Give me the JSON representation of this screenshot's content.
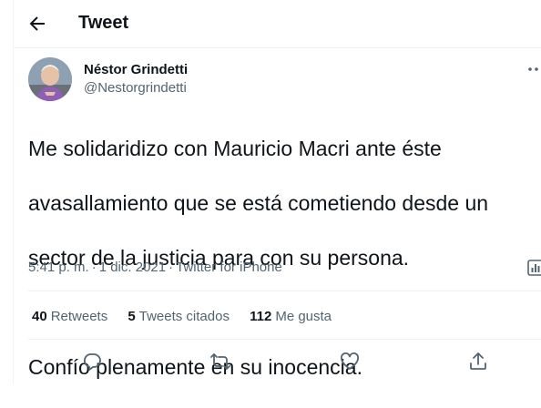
{
  "header": {
    "title": "Tweet"
  },
  "author": {
    "name": "Néstor Grindetti",
    "handle": "@Nestorgrindetti"
  },
  "tweet": {
    "lines": [
      "Me solidaridizo con Mauricio Macri ante éste",
      "avasallamiento que se está cometiendo desde un",
      "sector de la justicia para con su persona.",
      "",
      "Confío plenamente en su inocencia."
    ]
  },
  "meta": {
    "time": "5:41 p. m.",
    "separator": "·",
    "date": "1 dic. 2021",
    "source": "Twitter for iPhone"
  },
  "stats": {
    "retweets_count": "40",
    "retweets_label": "Retweets",
    "quotes_count": "5",
    "quotes_label": "Tweets citados",
    "likes_count": "112",
    "likes_label": "Me gusta"
  },
  "icons": {
    "back": "arrow-left-icon",
    "more": "more-dots-icon",
    "analytics": "analytics-icon",
    "reply": "reply-icon",
    "retweet": "retweet-icon",
    "like": "heart-icon",
    "share": "share-icon"
  },
  "colors": {
    "text": "#0f1419",
    "secondary": "#536471",
    "border": "#eff3f4"
  }
}
